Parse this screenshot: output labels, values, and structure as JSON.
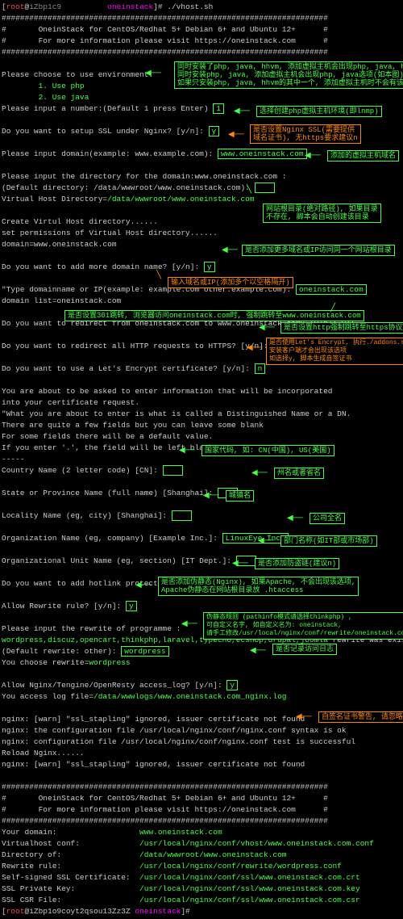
{
  "prompt": {
    "user": "root",
    "host": "iZbp1c9",
    "end": "]#",
    "cmd1": "oneinstack",
    "cmd2": "./vhost.sh",
    "user2": "root",
    "host2": "iZbp1o9coyt2qsou13Zz3Z"
  },
  "hash": "#######################################################################",
  "banner1": "#       OneinStack for CentOS/Redhat 5+ Debian 6+ and Ubuntu 12+      #",
  "banner2": "#       For more information please visit https://oneinstack.com      #",
  "menu": {
    "head": "Please choose to use environment:",
    "o1": "1. Use php",
    "o2": "2. Use java"
  },
  "q": {
    "num": "Please input a number:(Default 1 press Enter)",
    "ssl": "Do you want to setup SSL under Nginx? [y/n]:",
    "dom": "Please input domain(example: www.example.com):",
    "domval": "www.oneinstack.com",
    "dir1": "Please input the directory for the domain:www.oneinstack.com :",
    "dir2": "(Default directory: /data/wwwroot/www.oneinstack.com):",
    "dir3": "Virtual Host Directory=",
    "dirval": "/data/wwwroot/www.oneinstack.com",
    "cvh": "Create Virtul Host directory......",
    "perm": "set permissions of Virtual Host directory......",
    "dmn": "domain=www.oneinstack.com",
    "more": "Do you want to add more domain name? [y/n]:",
    "type": "\"Type domainname or IP(example: example.com other.example.com):",
    "typeval": "oneinstack.com",
    "dlist": "domain list=oneinstack.com",
    "redir": "Do you want to redirect from oneinstack.com to www.oneinstack.com? [y/n]:",
    "https": "Do you want to redirect all HTTP requests to HTTPS? [y/n]:",
    "le": "Do you want to use a Let's Encrypt certificate? [y/n]:",
    "cert1": "You are about to be asked to enter information that will be incorporated",
    "cert2": "into your certificate request.",
    "cert3": "\"What you are about to enter is what is called a Distinguished Name or a DN.",
    "cert4": "There are quite a few fields but you can leave some blank",
    "cert5": "For some fields there will be a default value.",
    "cert6": "If you enter '.', the field will be left blank.",
    "cert7": "-----",
    "cn": "Country Name (2 letter code) [CN]:",
    "st": "State or Province Name (full name) [Shanghai]:",
    "loc": "Locality Name (eg, city) [Shanghai]:",
    "org": "Organization Name (eg, company) [Example Inc.]:",
    "orgval": "LinuxEye Inc.",
    "ou": "Organizational Unit Name (eg, section) [IT Dept.]:",
    "hot": "Do you want to add hotlink protection? [y/n]:",
    "rew": "Allow Rewrite rule? [y/n]:",
    "rew1": "Please input the rewrite of programme :",
    "rew2": "wordpress,discuz,opencart,thinkphp,laravel,typecho,ecshop,drupal,joomla",
    "rew2b": " rewrite was exist.",
    "rew3": "(Default rewrite: other):",
    "rewval": "wordpress",
    "rew4": "You choose rewrite=",
    "log": "Allow Nginx/Tengine/OpenResty access_log? [y/n]:",
    "log2": "You access log file=",
    "logval": "/data/wwwlogs/www.oneinstack.com_nginx.log"
  },
  "n": {
    "w1": "nginx: [warn] \"ssl_stapling\" ignored, issuer certificate not found",
    "ok": "nginx: the configuration file /usr/local/nginx/conf/nginx.conf syntax is ok",
    "tst": "nginx: configuration file /usr/local/nginx/conf/nginx.conf test is successful",
    "rl": "Reload Nginx......"
  },
  "sm": {
    "sep": "#######################################################################",
    "yd": "Your domain:",
    "ydv": "www.oneinstack.com",
    "vh": "Virtualhost conf:",
    "vhv": "/usr/local/nginx/conf/vhost/www.oneinstack.com.conf",
    "di": "Directory of:",
    "div": "/data/wwwroot/www.oneinstack.com",
    "rw": "Rewrite rule:",
    "rwv": "/usr/local/nginx/conf/rewrite/wordpress.conf",
    "ss": "Self-signed SSL Certificate:",
    "ssv": "/usr/local/nginx/conf/ssl/www.oneinstack.com.crt",
    "pk": "SSL Private Key:",
    "pkv": "/usr/local/nginx/conf/ssl/www.oneinstack.com.key",
    "cs": "SSL CSR File:",
    "csv": "/usr/local/nginx/conf/ssl/www.oneinstack.com.csr"
  },
  "in": {
    "one": "1",
    "y": "y",
    "n": "n"
  },
  "a": {
    "a1": "同时安装了php, java, hhvm, 添加虚拟主机会出现php, java, hhvm选项",
    "a2": "同时安装php, java, 添加虚拟主机会出现php, java选项(如本图)",
    "a3": "如果只安装php, java, hhvm的其中一个, 添加虚拟主机时不会有该选项",
    "a4": "选择创建php虚拟主机环境(即lnmp)",
    "a5a": "是否设置Nginx SSL(需要提供",
    "a5b": "域名证书), 无https要求建议n",
    "a6": "添加的虚拟主机域名",
    "a7a": "网站根目录(绝对路径), 如果目录",
    "a7b": "不存在, 脚本会自动创建该目录",
    "a8": "是否添加更多域名或IP访问同一个网站根目录",
    "a9": "输入域名或IP(添加多个以空格隔开)",
    "a10": "是否设置301跳转, 浏览器访问oneinstack.com时, 强制跳转至www.oneinstack.com",
    "a11": "是否设置http强制跳转至https协议",
    "a12a": "是否使用Let's Encrypt, 执行./addons.sh",
    "a12b": "安装客户端才会出现该选项",
    "a12c": "如选择y, 脚本生成自签证书",
    "a13": "国家代码, 如: CN(中国), US(美国)",
    "a14": "州名或者省名",
    "a15": "城镇名",
    "a16": "公司全名",
    "a17": "部门名称(如IT部或市场部)",
    "a18": "是否添加防盗链(建议n)",
    "a19a": "是否添加伪静态(Nginx), 如果Apache, 不会出现该选项,",
    "a19b": "Apache伪静态在网站根目录放 .htaccess",
    "a20a": "伪静态规则 (pathinfo模式请选择thinkphp) ,",
    "a20b": "可自定义名字, 如自定义名为: oneinstack,",
    "a20c": "请手工修改/usr/local/nginx/conf/rewrite/oneinstack.conf",
    "a21": "是否记录访问日志",
    "a22": "自签名证书警告, 请忽略"
  }
}
